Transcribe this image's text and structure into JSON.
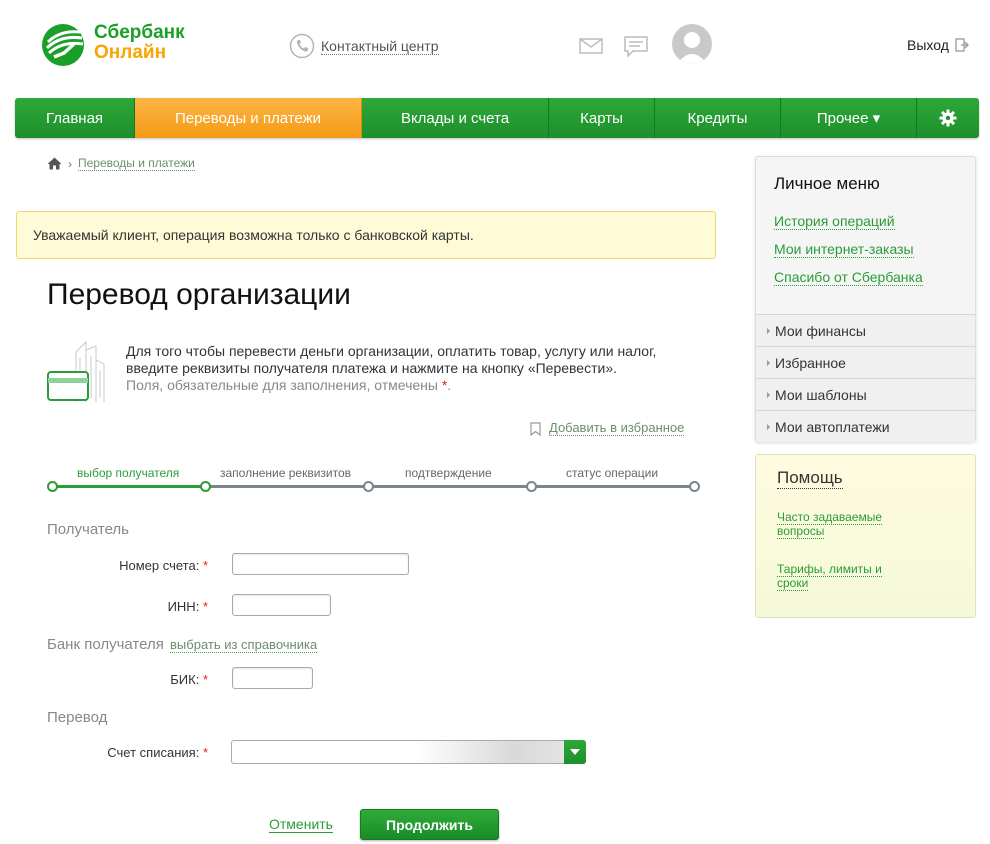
{
  "header": {
    "logo_line1": "Сбербанк",
    "logo_line2": "Онлайн",
    "contact_label": "Контактный центр",
    "exit_label": "Выход"
  },
  "nav": {
    "items": [
      {
        "label": "Главная",
        "active": false
      },
      {
        "label": "Переводы и платежи",
        "active": true
      },
      {
        "label": "Вклады и счета",
        "active": false
      },
      {
        "label": "Карты",
        "active": false
      },
      {
        "label": "Кредиты",
        "active": false
      },
      {
        "label": "Прочее ▾",
        "active": false
      }
    ],
    "settings_icon": "gear-icon"
  },
  "breadcrumb": {
    "home_icon": "home-icon",
    "link": "Переводы и платежи"
  },
  "warning": "Уважаемый клиент, операция возможна только с банковской карты.",
  "page_title": "Перевод организации",
  "intro": {
    "text": "Для того чтобы перевести деньги организации, оплатить товар, услугу или налог, введите реквизиты получателя платежа и нажмите на кнопку «Перевести».",
    "required_note": "Поля, обязательные для заполнения, отмечены",
    "required_star": "*",
    "required_end": "."
  },
  "favorites_label": "Добавить в избранное",
  "steps": [
    {
      "label": "выбор получателя",
      "active": true
    },
    {
      "label": "заполнение реквизитов",
      "active": false
    },
    {
      "label": "подтверждение",
      "active": false
    },
    {
      "label": "статус операции",
      "active": false
    }
  ],
  "form": {
    "section_recipient": "Получатель",
    "account_label": "Номер счета:",
    "inn_label": "ИНН:",
    "section_bank": "Банк получателя",
    "bank_directory_link": "выбрать из справочника",
    "bik_label": "БИК:",
    "section_transfer": "Перевод",
    "debit_account_label": "Счет списания:",
    "star": "*",
    "account_value": "",
    "inn_value": "",
    "bik_value": ""
  },
  "actions": {
    "cancel": "Отменить",
    "continue": "Продолжить"
  },
  "personal_menu": {
    "title": "Личное меню",
    "links": [
      "История операций",
      "Мои интернет-заказы",
      "Спасибо от Сбербанка"
    ],
    "sections": [
      "Мои финансы",
      "Избранное",
      "Мои шаблоны",
      "Мои автоплатежи"
    ]
  },
  "help": {
    "title": "Помощь",
    "links": [
      "Часто задаваемые вопросы",
      "Тарифы, лимиты и сроки"
    ]
  },
  "colors": {
    "brand_green": "#2ea83a",
    "brand_orange": "#f7a600",
    "link_green": "#2a9c38",
    "warning_bg": "#fffbd6"
  }
}
